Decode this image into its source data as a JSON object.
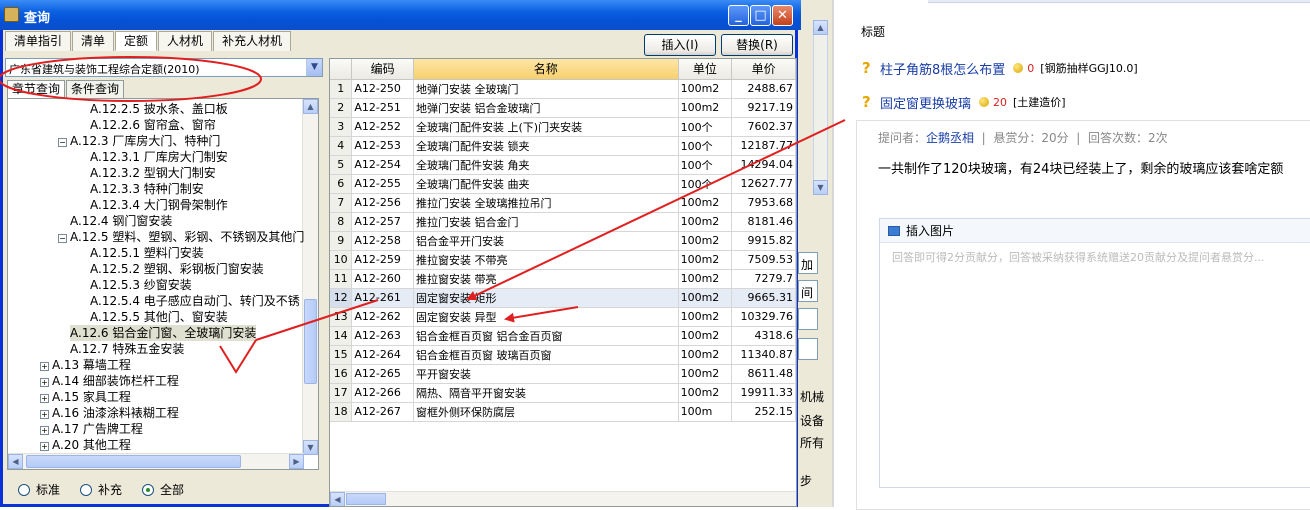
{
  "dialog": {
    "title": "查询",
    "main_tabs": [
      "清单指引",
      "清单",
      "定额",
      "人材机",
      "补充人材机"
    ],
    "active_tab": "定额",
    "insert_button": "插入(I)",
    "replace_button": "替换(R)",
    "quota_combo": "广东省建筑与装饰工程综合定额(2010)",
    "sub_tabs": [
      "章节查询",
      "条件查询"
    ],
    "tree": [
      {
        "text": "A.12.2.5 披水条、盖口板",
        "exp": ""
      },
      {
        "text": "A.12.2.6 窗帘盒、窗帘",
        "exp": ""
      },
      {
        "text": "A.12.3 厂库房大门、特种门",
        "exp": "−"
      },
      {
        "text": "A.12.3.1 厂库房大门制安",
        "exp": ""
      },
      {
        "text": "A.12.3.2 型钢大门制安",
        "exp": ""
      },
      {
        "text": "A.12.3.3 特种门制安",
        "exp": ""
      },
      {
        "text": "A.12.3.4 大门钢骨架制作",
        "exp": ""
      },
      {
        "text": "A.12.4 钢门窗安装",
        "exp": ""
      },
      {
        "text": "A.12.5 塑料、塑钢、彩钢、不锈钢及其他门",
        "exp": "−"
      },
      {
        "text": "A.12.5.1 塑料门安装",
        "exp": ""
      },
      {
        "text": "A.12.5.2 塑钢、彩钢板门窗安装",
        "exp": ""
      },
      {
        "text": "A.12.5.3 纱窗安装",
        "exp": ""
      },
      {
        "text": "A.12.5.4 电子感应自动门、转门及不锈",
        "exp": ""
      },
      {
        "text": "A.12.5.5 其他门、窗安装",
        "exp": ""
      },
      {
        "text": "A.12.6 铝合金门窗、全玻璃门安装",
        "exp": ""
      },
      {
        "text": "A.12.7 特殊五金安装",
        "exp": ""
      },
      {
        "text": "A.13 幕墙工程",
        "exp": "+"
      },
      {
        "text": "A.14 细部装饰栏杆工程",
        "exp": "+"
      },
      {
        "text": "A.15 家具工程",
        "exp": "+"
      },
      {
        "text": "A.16 油漆涂料裱糊工程",
        "exp": "+"
      },
      {
        "text": "A.17 广告牌工程",
        "exp": "+"
      },
      {
        "text": "A.20 其他工程",
        "exp": "+"
      }
    ],
    "radios": [
      "标准",
      "补充",
      "全部"
    ],
    "selected_radio": "全部",
    "grid": {
      "columns": [
        "",
        "编码",
        "名称",
        "单位",
        "单价"
      ],
      "rows": [
        [
          "1",
          "A12-250",
          "地弹门安装 全玻璃门",
          "100m2",
          "2488.67"
        ],
        [
          "2",
          "A12-251",
          "地弹门安装 铝合金玻璃门",
          "100m2",
          "9217.19"
        ],
        [
          "3",
          "A12-252",
          "全玻璃门配件安装 上(下)门夹安装",
          "100个",
          "7602.37"
        ],
        [
          "4",
          "A12-253",
          "全玻璃门配件安装 锁夹",
          "100个",
          "12187.77"
        ],
        [
          "5",
          "A12-254",
          "全玻璃门配件安装 角夹",
          "100个",
          "14294.04"
        ],
        [
          "6",
          "A12-255",
          "全玻璃门配件安装 曲夹",
          "100个",
          "12627.77"
        ],
        [
          "7",
          "A12-256",
          "推拉门安装 全玻璃推拉吊门",
          "100m2",
          "7953.68"
        ],
        [
          "8",
          "A12-257",
          "推拉门安装 铝合金门",
          "100m2",
          "8181.46"
        ],
        [
          "9",
          "A12-258",
          "铝合金平开门安装",
          "100m2",
          "9915.82"
        ],
        [
          "10",
          "A12-259",
          "推拉窗安装 不带亮",
          "100m2",
          "7509.53"
        ],
        [
          "11",
          "A12-260",
          "推拉窗安装 带亮",
          "100m2",
          "7279.7"
        ],
        [
          "12",
          "A12-261",
          "固定窗安装 矩形",
          "100m2",
          "9665.31"
        ],
        [
          "13",
          "A12-262",
          "固定窗安装 异型",
          "100m2",
          "10329.76"
        ],
        [
          "14",
          "A12-263",
          "铝合金框百页窗 铝合金百页窗",
          "100m2",
          "4318.6"
        ],
        [
          "15",
          "A12-264",
          "铝合金框百页窗 玻璃百页窗",
          "100m2",
          "11340.87"
        ],
        [
          "16",
          "A12-265",
          "平开窗安装",
          "100m2",
          "8611.48"
        ],
        [
          "17",
          "A12-266",
          "隔热、隔音平开窗安装",
          "100m2",
          "19911.33"
        ],
        [
          "18",
          "A12-267",
          "窗框外侧环保防腐层",
          "100m",
          "252.15"
        ]
      ]
    }
  },
  "midstrip": {
    "labels": [
      "机械",
      "设备",
      "所有",
      "步"
    ],
    "buttons": [
      "加",
      "间"
    ]
  },
  "web": {
    "heading": "标题",
    "questions": [
      {
        "title": "柱子角筋8根怎么布置",
        "score": "0",
        "category": "[钢筋抽样GGJ10.0]"
      },
      {
        "title": "固定窗更换玻璃",
        "score": "20",
        "category": "[土建造价]"
      }
    ],
    "meta": {
      "asker_label": "提问者：",
      "asker": "企鹅丞相",
      "sep1": "|",
      "reward": "悬赏分：20分",
      "sep2": "|",
      "answers": "回答次数：2次"
    },
    "body": "一共制作了120块玻璃，有24块已经装上了，剩余的玻璃应该套啥定额",
    "insert_image": "插入图片",
    "answer_placeholder": "回答即可得2分贡献分，回答被采纳获得系统赠送20贡献分及提问者悬赏分..."
  },
  "colors": {
    "title_bar": "#0a5fe0",
    "annotation": "#e02020",
    "link": "#1a3ea8"
  }
}
